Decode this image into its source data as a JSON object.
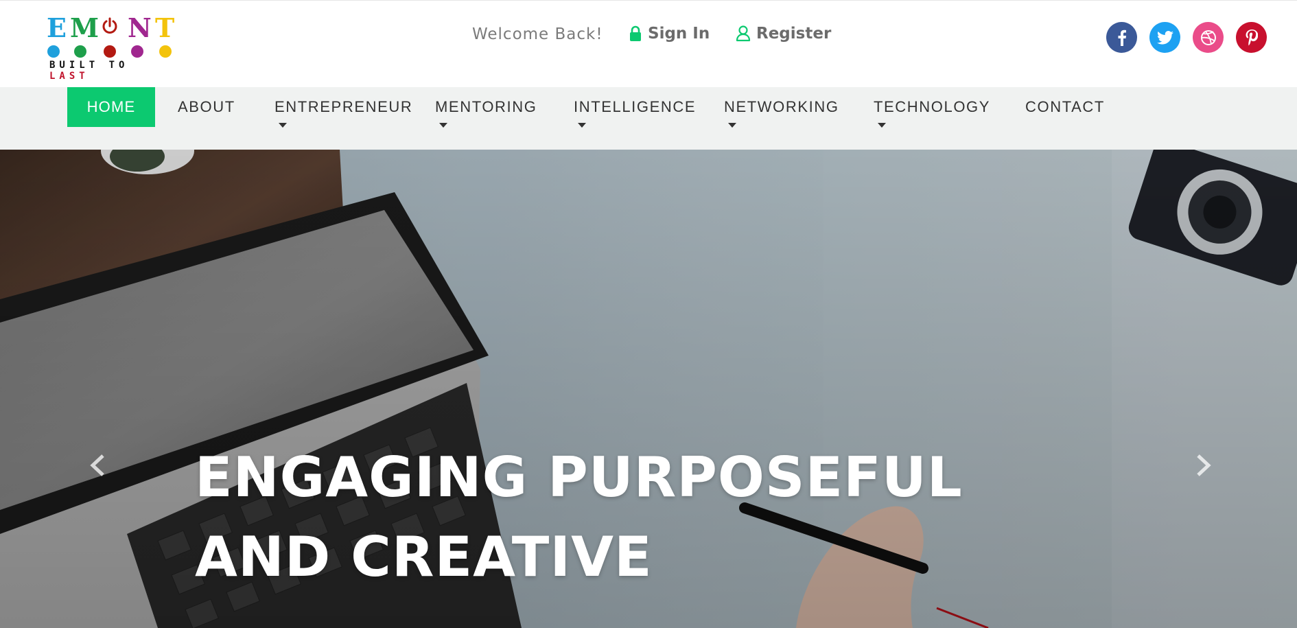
{
  "logo": {
    "letters": [
      "E",
      "M",
      "N",
      "T"
    ],
    "tagline_main": "BUILT TO ",
    "tagline_accent": "LAST",
    "colors": [
      "#1fa0dc",
      "#1e9f4b",
      "#b31a12",
      "#a0278f",
      "#f3c30c"
    ]
  },
  "header": {
    "welcome": "Welcome Back!",
    "sign_in": "Sign In",
    "register": "Register",
    "accent": "#0cc970"
  },
  "social": [
    {
      "name": "facebook",
      "color": "#3b5998"
    },
    {
      "name": "twitter",
      "color": "#1da1f2"
    },
    {
      "name": "dribbble",
      "color": "#ea4c89"
    },
    {
      "name": "pinterest",
      "color": "#c8102e"
    }
  ],
  "nav": {
    "home": "HOME",
    "items": [
      {
        "label": "ABOUT",
        "dropdown": false
      },
      {
        "label": "ENTREPRENEUR",
        "dropdown": true
      },
      {
        "label": "MENTORING",
        "dropdown": true
      },
      {
        "label": "INTELLIGENCE",
        "dropdown": true
      },
      {
        "label": "NETWORKING",
        "dropdown": true
      },
      {
        "label": "TECHNOLOGY",
        "dropdown": true
      },
      {
        "label": "CONTACT",
        "dropdown": false
      }
    ]
  },
  "hero": {
    "title_line1": "ENGAGING PURPOSEFUL",
    "title_line2": "AND CREATIVE",
    "prev_icon": "chevron-left-icon",
    "next_icon": "chevron-right-icon"
  }
}
